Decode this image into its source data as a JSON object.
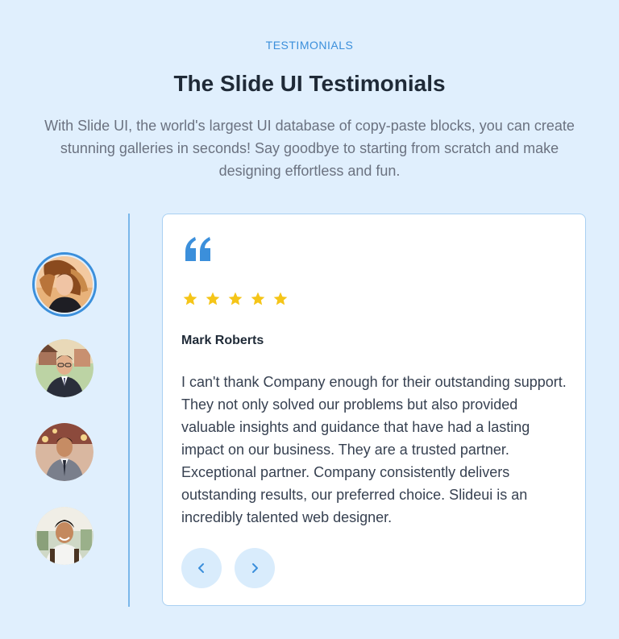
{
  "header": {
    "eyebrow": "TESTIMONIALS",
    "title": "The Slide UI Testimonials",
    "subtitle": "With Slide UI, the world's largest UI database of copy-paste blocks, you can create stunning galleries in seconds! Say goodbye to starting from scratch and make designing effortless and fun."
  },
  "avatars": [
    {
      "icon": "avatar-woman-icon",
      "active": true
    },
    {
      "icon": "avatar-man-suit-icon",
      "active": false
    },
    {
      "icon": "avatar-man-tie-icon",
      "active": false
    },
    {
      "icon": "avatar-man-smiling-icon",
      "active": false
    }
  ],
  "testimonial": {
    "quote_icon": "quote-icon",
    "rating": 5,
    "rating_max": 5,
    "name": "Mark Roberts",
    "text": "I can't thank Company enough for their outstanding support. They not only solved our problems but also provided valuable insights and guidance that have had a lasting impact on our business. They are a trusted partner. Exceptional partner. Company consistently delivers outstanding results, our preferred choice. Slideui is an incredibly talented web designer."
  },
  "nav": {
    "prev_icon": "chevron-left-icon",
    "next_icon": "chevron-right-icon"
  },
  "colors": {
    "background": "#e0effd",
    "accent": "#3b8fdb",
    "star": "#f5c518",
    "title": "#1f2a37",
    "body_text": "#374151",
    "muted_text": "#6b7280"
  }
}
